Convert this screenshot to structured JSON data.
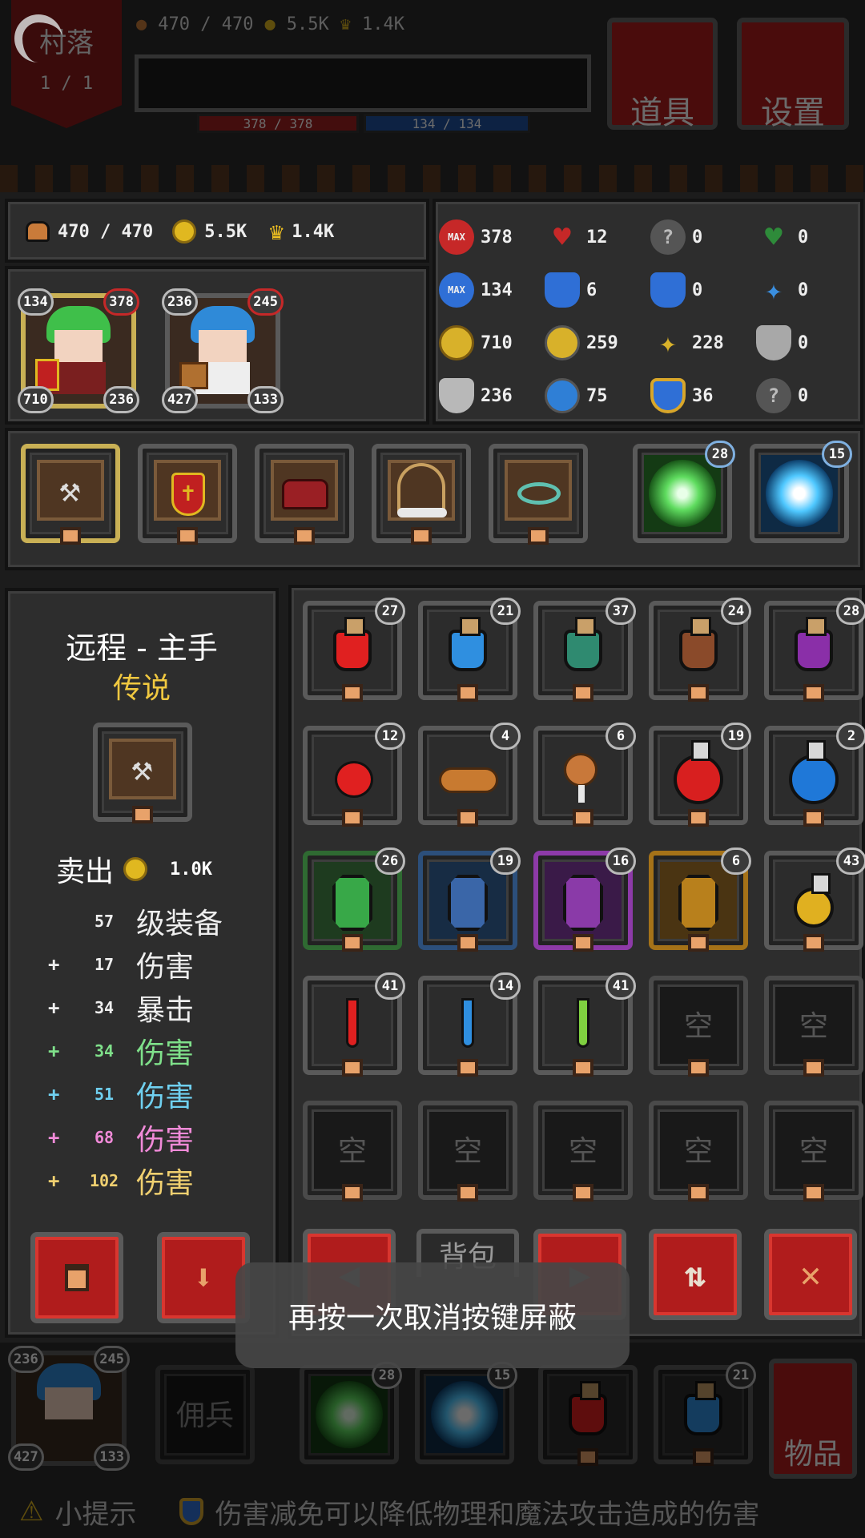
{
  "top": {
    "village": "村落",
    "village_page": "1  /  1",
    "food": "470 / 470",
    "gold": "5.5K",
    "crown": "1.4K",
    "hp_bar": "378 / 378",
    "mp_bar": "134 / 134",
    "btn_items": "道具",
    "btn_settings": "设置"
  },
  "resources": {
    "food": "470 / 470",
    "gold": "5.5K",
    "crown": "1.4K"
  },
  "stats": [
    {
      "icon": "max-heart-icon",
      "badge": "MAX",
      "value": "378",
      "color": "#c62828"
    },
    {
      "icon": "heart-plus-icon",
      "value": "12",
      "color": "#c62828"
    },
    {
      "icon": "unknown-gear-icon",
      "value": "0",
      "color": "#777777"
    },
    {
      "icon": "green-heart-icon",
      "value": "0",
      "color": "#2e8b3a"
    },
    {
      "icon": "max-mana-icon",
      "badge": "MAX",
      "value": "134",
      "color": "#2f6fd6"
    },
    {
      "icon": "mana-plus-icon",
      "value": "6",
      "color": "#2f6fd6"
    },
    {
      "icon": "mana-regen-icon",
      "value": "0",
      "color": "#2f6fd6"
    },
    {
      "icon": "blue-star-icon",
      "value": "0",
      "color": "#3a8fe0"
    },
    {
      "icon": "attack-orb-icon",
      "value": "710",
      "color": "#d8b12a"
    },
    {
      "icon": "gold-orb-icon",
      "value": "259",
      "color": "#d8b12a"
    },
    {
      "icon": "gold-star-icon",
      "value": "228",
      "color": "#d8b12a"
    },
    {
      "icon": "dodge-shield-icon",
      "value": "0",
      "color": "#a8a8a8"
    },
    {
      "icon": "armor-shield-icon",
      "value": "236",
      "color": "#b8b8b8"
    },
    {
      "icon": "magic-orb-icon",
      "value": "75",
      "color": "#2f7fd6"
    },
    {
      "icon": "resist-shield-icon",
      "value": "36",
      "color": "#d8a62a"
    },
    {
      "icon": "unknown-shield-icon",
      "value": "0",
      "color": "#777777"
    }
  ],
  "heroes": [
    {
      "name": "green-knight",
      "top_left": "134",
      "top_right": "378",
      "bottom_left": "710",
      "bottom_right": "236"
    },
    {
      "name": "blue-maid",
      "top_left": "236",
      "top_right": "245",
      "bottom_left": "427",
      "bottom_right": "133"
    }
  ],
  "equipment": [
    {
      "icon": "axe-icon"
    },
    {
      "icon": "cross-shield-icon"
    },
    {
      "icon": "red-armor-icon"
    },
    {
      "icon": "bone-amulet-icon"
    },
    {
      "icon": "teal-ring-icon"
    }
  ],
  "skills": [
    {
      "icon": "green-vortex-icon",
      "level": "28"
    },
    {
      "icon": "blue-aura-icon",
      "level": "15"
    }
  ],
  "detail": {
    "title": "远程 - 主手",
    "rarity": "传说",
    "sell_label": "卖出",
    "sell_price": "1.0K",
    "attrs": [
      {
        "prefix": "",
        "value": "57",
        "label": "级装备",
        "color": "#eeeeee"
      },
      {
        "prefix": "+",
        "value": "17",
        "label": "伤害",
        "color": "#eeeeee"
      },
      {
        "prefix": "+",
        "value": "34",
        "label": "暴击",
        "color": "#eeeeee"
      },
      {
        "prefix": "+",
        "value": "34",
        "label": "伤害",
        "color": "#7fe08a"
      },
      {
        "prefix": "+",
        "value": "51",
        "label": "伤害",
        "color": "#6fd0f0"
      },
      {
        "prefix": "+",
        "value": "68",
        "label": "伤害",
        "color": "#f08ad8"
      },
      {
        "prefix": "+",
        "value": "102",
        "label": "伤害",
        "color": "#f0d070"
      }
    ]
  },
  "inventory": {
    "empty_label": "空",
    "bag_label": "背包",
    "counts": [
      "27",
      "21",
      "37",
      "24",
      "28",
      "12",
      "4",
      "6",
      "19",
      "2",
      "26",
      "19",
      "16",
      "6",
      "43",
      "41",
      "14",
      "41"
    ]
  },
  "toast": "再按一次取消按键屏蔽",
  "bottom": {
    "hero_top_left": "236",
    "hero_top_right": "245",
    "hero_bottom_left": "427",
    "hero_bottom_right": "133",
    "mercenary": "佣兵",
    "items": "物品",
    "skill1_level": "28",
    "skill2_level": "15",
    "pot1_count": "",
    "pot2_count": "21"
  },
  "tip": {
    "label": "小提示",
    "text": "伤害减免可以降低物理和魔法攻击造成的伤害"
  }
}
